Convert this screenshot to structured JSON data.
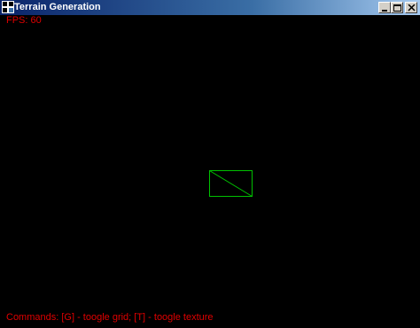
{
  "window": {
    "title": "Terrain Generation",
    "icon": "app-icon"
  },
  "caption_buttons": {
    "minimize": "minimize-icon",
    "maximize": "maximize-icon",
    "close": "close-icon"
  },
  "hud": {
    "fps": "FPS: 60",
    "commands": "Commands: [G] - toogle grid; [T] - toogle texture"
  },
  "colors": {
    "hud_text": "#e00000",
    "grid_line": "#00c000",
    "background": "#000000"
  }
}
